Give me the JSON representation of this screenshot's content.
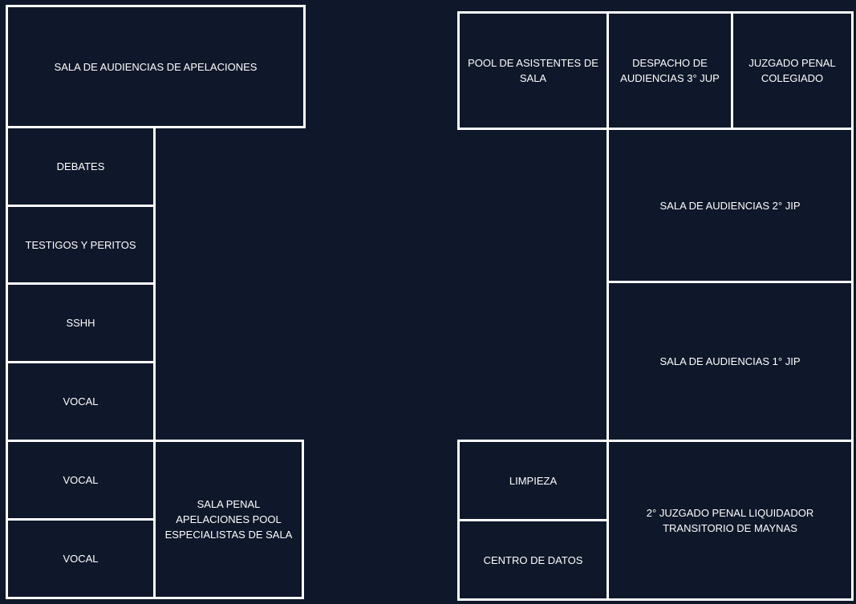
{
  "floor_plan": {
    "background_color": "#0f172a",
    "wall_color": "#ffffff",
    "text_color": "#ffffff",
    "left_wing": {
      "sala_apelaciones": "SALA DE AUDIENCIAS DE APELACIONES",
      "debates": "DEBATES",
      "testigos_peritos": "TESTIGOS Y PERITOS",
      "sshh": "SSHH",
      "vocal_1": "VOCAL",
      "vocal_2": "VOCAL",
      "vocal_3": "VOCAL",
      "sala_penal": "SALA PENAL\nAPELACIONES POOL\nESPECIALISTAS DE SALA"
    },
    "right_wing": {
      "pool_asistentes": "POOL DE ASISTENTES DE\nSALA",
      "despacho_3jup": "DESPACHO DE\nAUDIENCIAS 3° JUP",
      "juzgado_colegiado": "JUZGADO PENAL\nCOLEGIADO",
      "sala_2jip": "SALA DE AUDIENCIAS 2° JIP",
      "sala_1jip": "SALA DE AUDIENCIAS 1° JIP",
      "limpieza": "LIMPIEZA",
      "centro_datos": "CENTRO DE DATOS",
      "juzgado_liquidador": "2° JUZGADO PENAL LIQUIDADOR\nTRANSITORIO DE MAYNAS"
    }
  }
}
